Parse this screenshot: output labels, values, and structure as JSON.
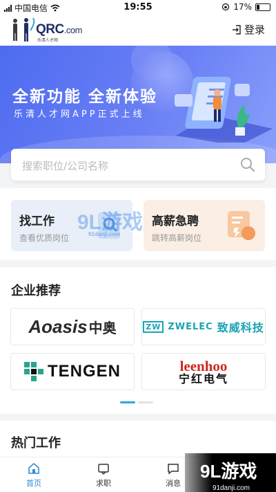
{
  "status_bar": {
    "carrier": "中国电信",
    "time": "19:55",
    "battery": "17%"
  },
  "header": {
    "logo_text": "QRC",
    "logo_suffix": ".com",
    "logo_sub": "乐清人才网",
    "login_label": "登录"
  },
  "banner": {
    "title": "全新功能 全新体验",
    "subtitle": "乐清人才网APP正式上线"
  },
  "search": {
    "placeholder": "搜索职位/公司名称"
  },
  "quick_entries": [
    {
      "title": "找工作",
      "subtitle": "查看优质岗位"
    },
    {
      "title": "高薪急聘",
      "subtitle": "跳转高薪岗位"
    }
  ],
  "companies": {
    "title": "企业推荐",
    "items": [
      {
        "en": "Aoasis",
        "cn": "中奥"
      },
      {
        "en": "ZWELEC",
        "mark": "ZW",
        "cn": "致威科技"
      },
      {
        "en": "TENGEN"
      },
      {
        "en": "leenhoo",
        "cn": "宁红电气"
      }
    ],
    "carousel_pages": 2,
    "carousel_active": 1
  },
  "hot_jobs": {
    "title": "热门工作"
  },
  "tabbar": [
    {
      "label": "首页",
      "icon": "home-icon",
      "active": true
    },
    {
      "label": "求职",
      "icon": "briefcase-icon",
      "active": false
    },
    {
      "label": "消息",
      "icon": "message-icon",
      "active": false
    }
  ],
  "watermarks": {
    "main": "9L游戏",
    "url": "91danji.com"
  },
  "colors": {
    "accent": "#2f8cd6",
    "banner": "#5a73f0",
    "find_card": "#e9eff8",
    "hire_card": "#fbeee4"
  }
}
